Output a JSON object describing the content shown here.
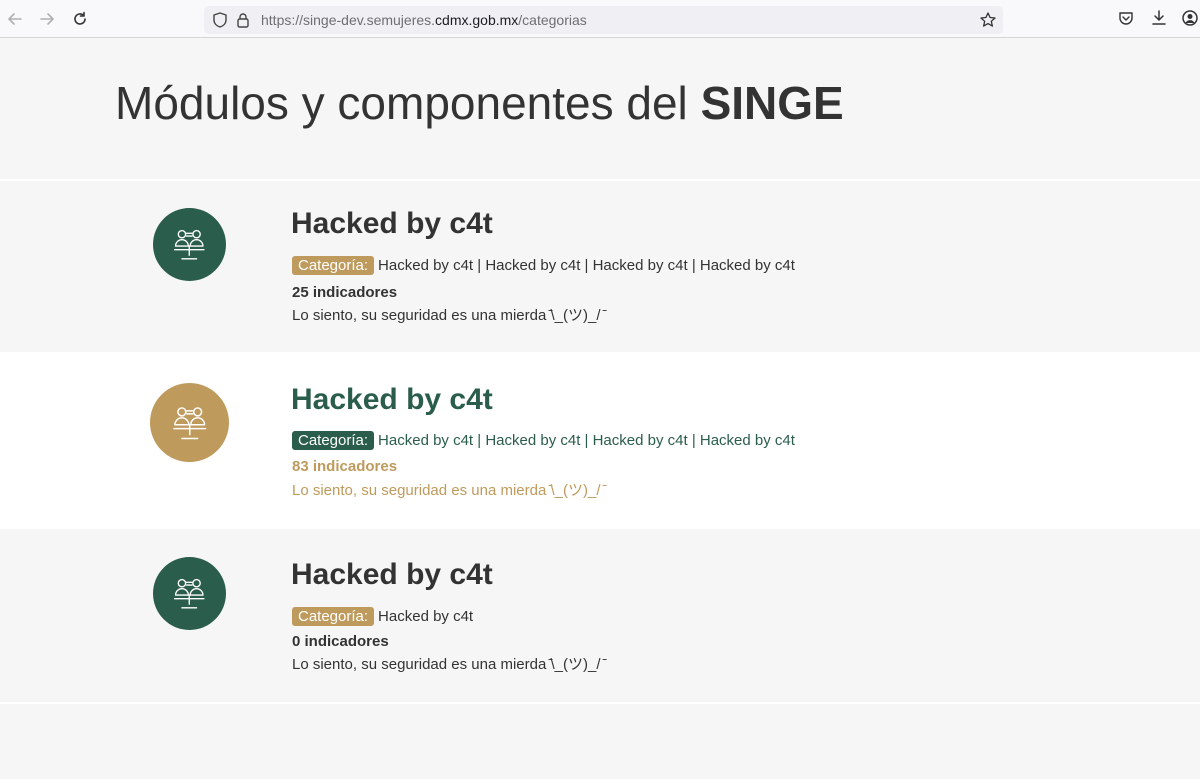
{
  "browser": {
    "url_prefix": "https://singe-dev.semujeres.",
    "url_host": "cdmx.gob.mx",
    "url_path": "/categorias"
  },
  "colors": {
    "green": "#2b5d4c",
    "gold": "#bf9a5d",
    "text_dark": "#333333"
  },
  "page": {
    "title_regular": "Módulos y componentes del ",
    "title_bold": "SINGE"
  },
  "cards": [
    {
      "title": "Hacked by c4t",
      "category_label": "Categoría:",
      "category_text": "Hacked by c4t | Hacked by c4t | Hacked by c4t | Hacked by c4t",
      "indicators": "25 indicadores",
      "description": "Lo siento, su seguridad es una mierda  ̄\\_(ツ)_/ ̄",
      "icon": "people-scale-icon"
    },
    {
      "title": "Hacked by c4t",
      "category_label": "Categoría:",
      "category_text": "Hacked by c4t | Hacked by c4t | Hacked by c4t | Hacked by c4t",
      "indicators": "83 indicadores",
      "description": "Lo siento, su seguridad es una mierda  ̄\\_(ツ)_/ ̄",
      "icon": "people-scale-icon"
    },
    {
      "title": "Hacked by c4t",
      "category_label": "Categoría:",
      "category_text": "Hacked by c4t",
      "indicators": "0 indicadores",
      "description": "Lo siento, su seguridad es una mierda  ̄\\_(ツ)_/ ̄",
      "icon": "people-scale-icon"
    }
  ]
}
